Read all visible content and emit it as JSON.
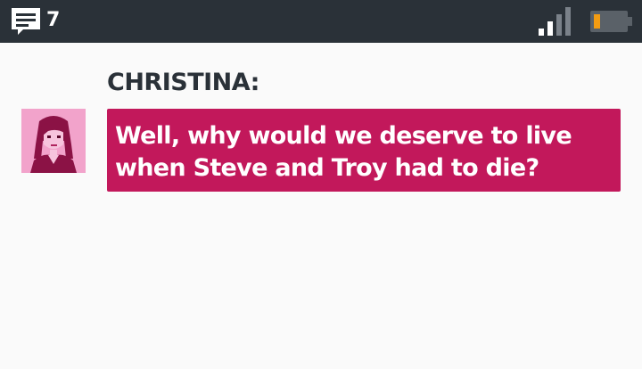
{
  "status_bar": {
    "message_icon": "chat-bubble-icon",
    "message_count": "7",
    "signal_icon": "signal-bars-icon",
    "battery_icon": "battery-low-icon",
    "bar_color": "#2a3138",
    "battery_fill_color": "#f39c12"
  },
  "dialogue": {
    "speaker": "CHRISTINA:",
    "text": "Well, why would we deserve to live when Steve and Troy had to die?",
    "avatar_icon": "christina-portrait",
    "bubble_color": "#c2185b",
    "avatar_bg_color": "#f2a3cb"
  }
}
